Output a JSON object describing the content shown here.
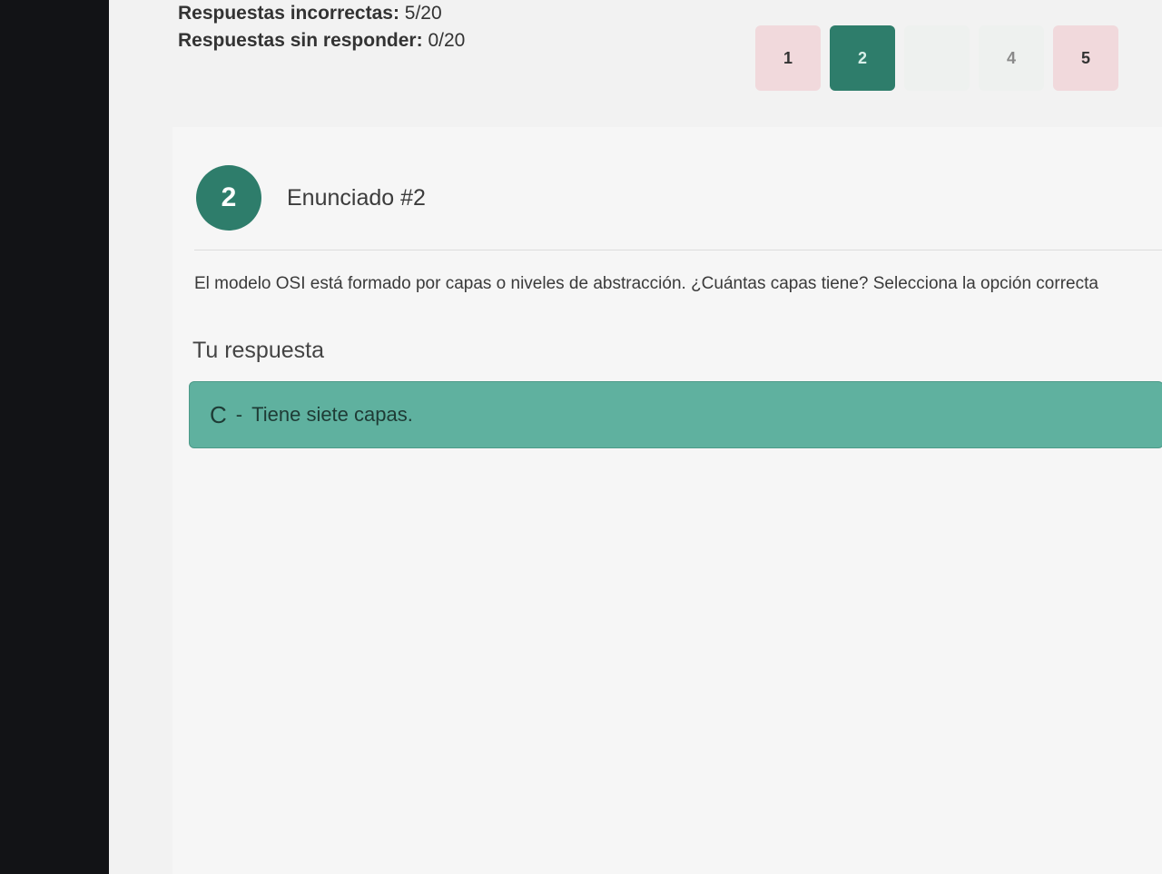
{
  "stats": {
    "incorrect_label": "Respuestas incorrectas:",
    "incorrect_value": "5/20",
    "unanswered_label": "Respuestas sin responder:",
    "unanswered_value": "0/20"
  },
  "pager": [
    "1",
    "2",
    "",
    "4",
    "5"
  ],
  "question": {
    "number": "2",
    "title": "Enunciado #2",
    "text": "El modelo OSI está formado por capas o niveles de abstracción. ¿Cuántas capas tiene? Selecciona la opción correcta"
  },
  "answer": {
    "label": "Tu respuesta",
    "letter": "C",
    "separator": "-",
    "text": "Tiene siete capas."
  }
}
